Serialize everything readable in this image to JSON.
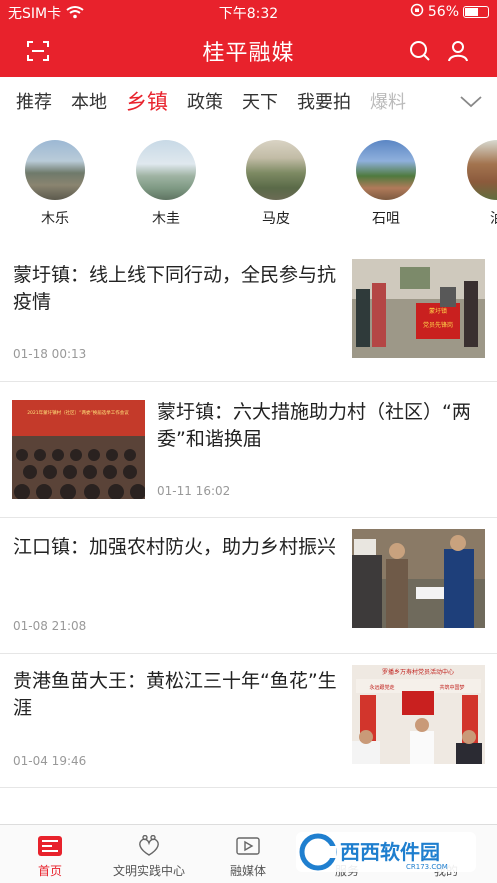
{
  "status": {
    "carrier": "无SIM卡",
    "time": "下午8:32",
    "battery": "56%"
  },
  "header": {
    "title": "桂平融媒"
  },
  "tabs": [
    {
      "label": "推荐",
      "state": "normal"
    },
    {
      "label": "本地",
      "state": "normal"
    },
    {
      "label": "乡镇",
      "state": "active"
    },
    {
      "label": "政策",
      "state": "normal"
    },
    {
      "label": "天下",
      "state": "normal"
    },
    {
      "label": "我要拍",
      "state": "normal"
    },
    {
      "label": "爆料",
      "state": "fade"
    }
  ],
  "towns": [
    {
      "name": "木乐"
    },
    {
      "name": "木圭"
    },
    {
      "name": "马皮"
    },
    {
      "name": "石咀"
    },
    {
      "name": "油"
    }
  ],
  "news": [
    {
      "title": "蒙圩镇：线上线下同行动，全民参与抗疫情",
      "time": "01-18 00:13",
      "image": "right"
    },
    {
      "title": "蒙圩镇：六大措施助力村（社区）“两委”和谐换届",
      "time": "01-11 16:02",
      "image": "left"
    },
    {
      "title": "江口镇：加强农村防火，助力乡村振兴",
      "time": "01-08 21:08",
      "image": "right"
    },
    {
      "title": "贵港鱼苗大王：黄松江三十年“鱼花”生涯",
      "time": "01-04 19:46",
      "image": "right"
    }
  ],
  "thumb_text": {
    "n1_sign": "党员先锋岗",
    "n1_sign_top": "蒙圩镇",
    "n2_banner": "2021年蒙圩镇村（社区）“两委”换届选举工作会议",
    "n4_banner": "罗播乡万寿村党员活动中心",
    "n4_sub1": "永远跟党走",
    "n4_sub2": "共筑中国梦"
  },
  "tabbar": [
    {
      "label": "首页",
      "state": "active"
    },
    {
      "label": "文明实践中心",
      "state": "normal"
    },
    {
      "label": "融媒体",
      "state": "normal"
    },
    {
      "label": "服务",
      "state": "normal"
    },
    {
      "label": "我的",
      "state": "normal"
    }
  ],
  "watermark": {
    "text": "西西软件园",
    "sub": "CR173.COM"
  },
  "colors": {
    "accent": "#e8222c",
    "text": "#222222",
    "muted": "#999999"
  }
}
